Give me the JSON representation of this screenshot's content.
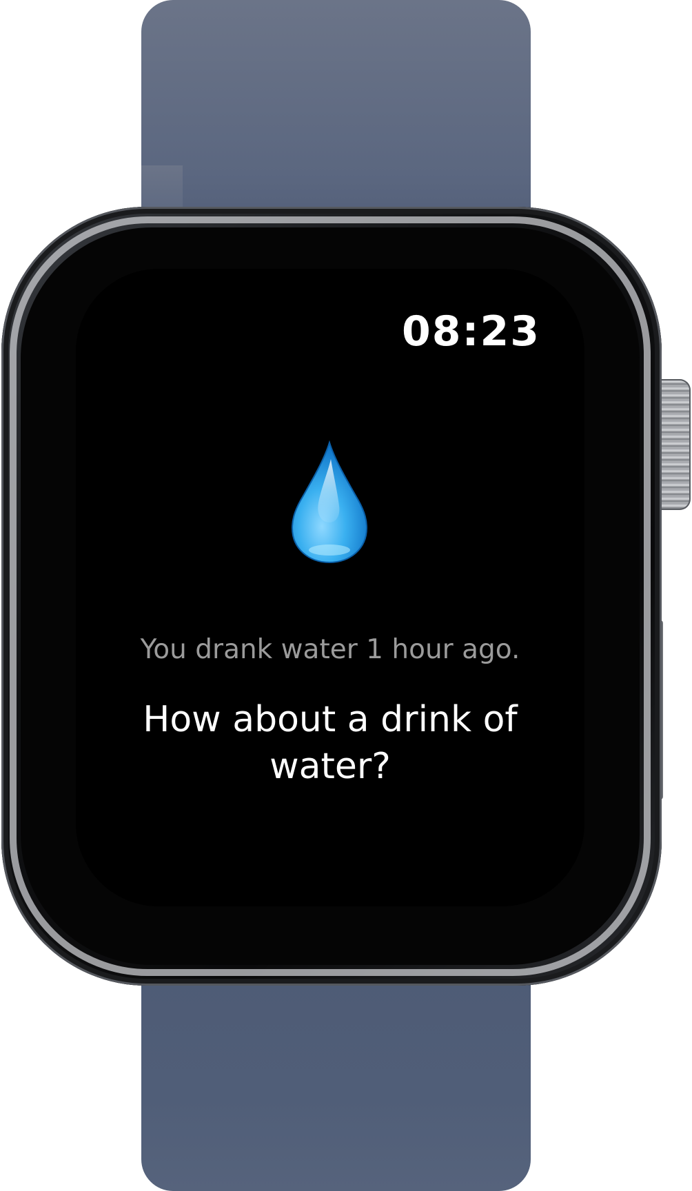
{
  "watch": {
    "band_color": "#56637b",
    "case_color": "#0a0a0b"
  },
  "screen": {
    "time": "08:23",
    "icon": "water-drop-icon",
    "last_drink_text": "You drank water 1 hour ago.",
    "prompt_text": "How about a drink of water?"
  },
  "colors": {
    "accent": "#2f9be6",
    "secondary_text": "#9b9b9b",
    "primary_text": "#ffffff",
    "background": "#000000"
  }
}
